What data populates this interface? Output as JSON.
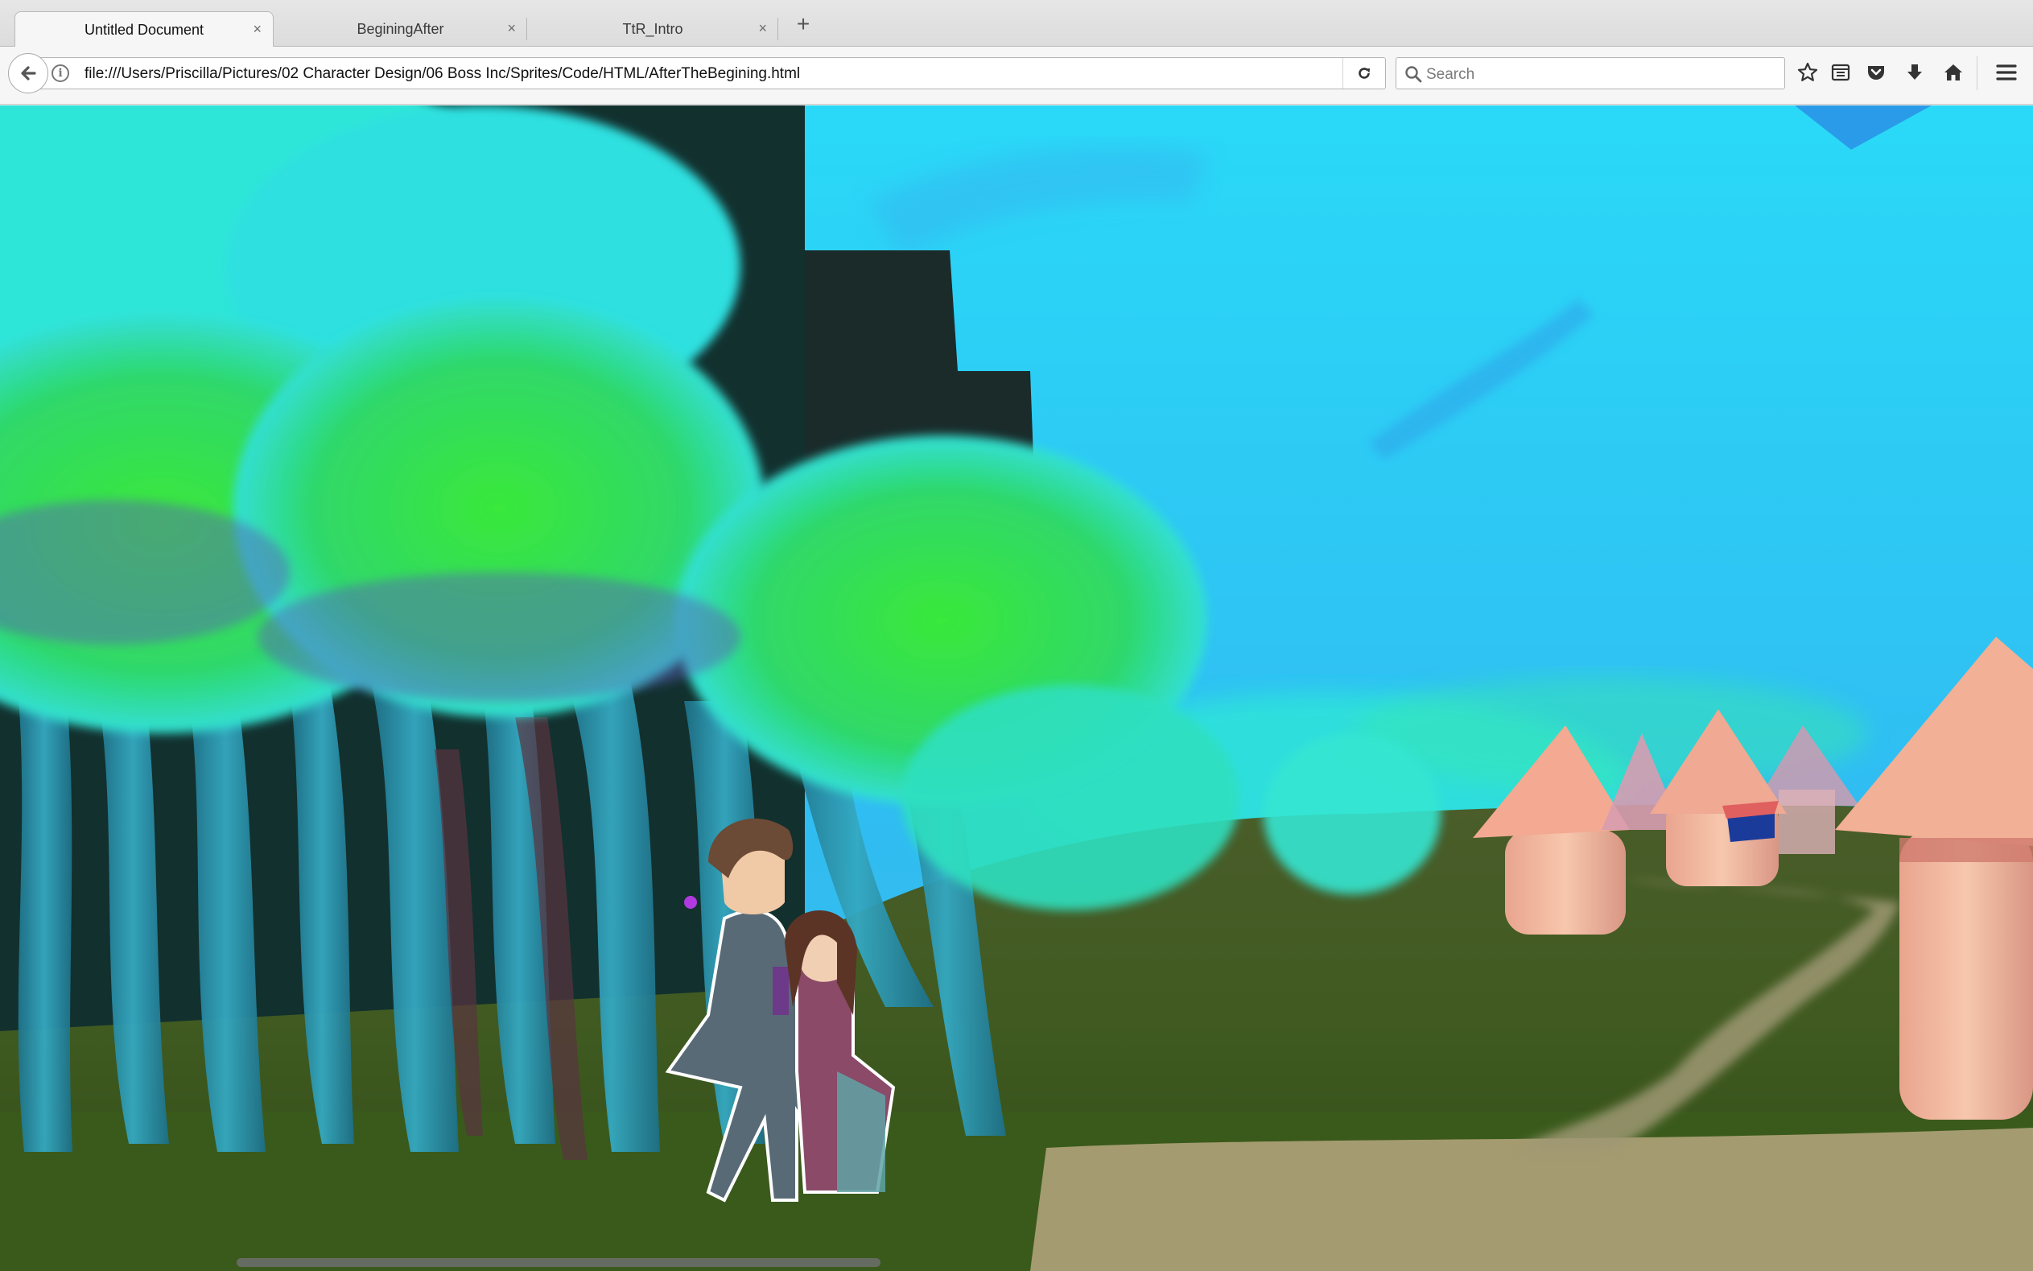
{
  "tabs": [
    {
      "title": "Untitled Document",
      "active": true
    },
    {
      "title": "BeginingAfter",
      "active": false
    },
    {
      "title": "TtR_Intro",
      "active": false
    }
  ],
  "tab_close_glyph": "×",
  "new_tab_glyph": "+",
  "address_bar": {
    "url": "file:///Users/Priscilla/Pictures/02 Character Design/06 Boss Inc/Sprites/Code/HTML/AfterTheBegining.html",
    "info_glyph": "i"
  },
  "search_bar": {
    "placeholder": "Search"
  },
  "toolbar_icons": [
    "back-arrow-icon",
    "site-info-icon",
    "reload-icon",
    "search-icon",
    "bookmark-star-icon",
    "reading-list-icon",
    "pocket-icon",
    "download-icon",
    "home-icon",
    "menu-icon"
  ],
  "page_content": {
    "description_icon": "game-scene-illustration"
  },
  "colors": {
    "sky": "#2fc7f4",
    "foliage_green": "#35e02e",
    "foliage_cyan": "#2ee6e0",
    "trunk": "#2a8fa8",
    "grass": "#3e5a1e",
    "path": "#a49a6e",
    "hut_pink": "#f2b49a"
  }
}
